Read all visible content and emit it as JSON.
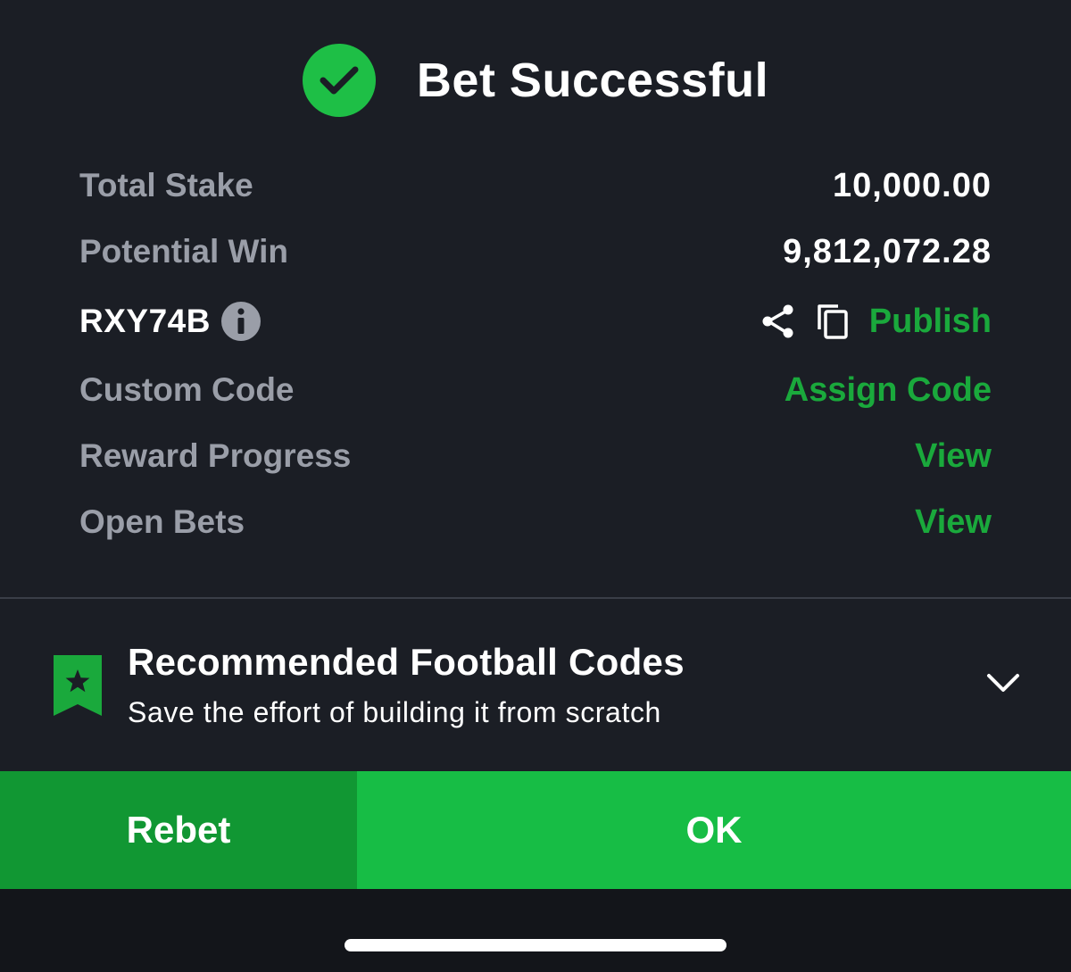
{
  "header": {
    "title": "Bet Successful",
    "icon": "check-circle-icon"
  },
  "summary": {
    "total_stake_label": "Total Stake",
    "total_stake_value": "10,000.00",
    "potential_win_label": "Potential Win",
    "potential_win_value": "9,812,072.28",
    "booking_code": "RXY74B",
    "publish_label": "Publish",
    "custom_code_label": "Custom Code",
    "assign_code_label": "Assign Code",
    "reward_progress_label": "Reward Progress",
    "reward_progress_action": "View",
    "open_bets_label": "Open Bets",
    "open_bets_action": "View"
  },
  "recommended": {
    "title": "Recommended Football Codes",
    "subtitle": "Save the effort of building it from scratch"
  },
  "buttons": {
    "rebet": "Rebet",
    "ok": "OK"
  },
  "colors": {
    "background": "#1b1e25",
    "accent_green": "#1aa93c",
    "button_rebet": "#119733",
    "button_ok": "#17bd45",
    "label_gray": "#9a9ea8"
  }
}
